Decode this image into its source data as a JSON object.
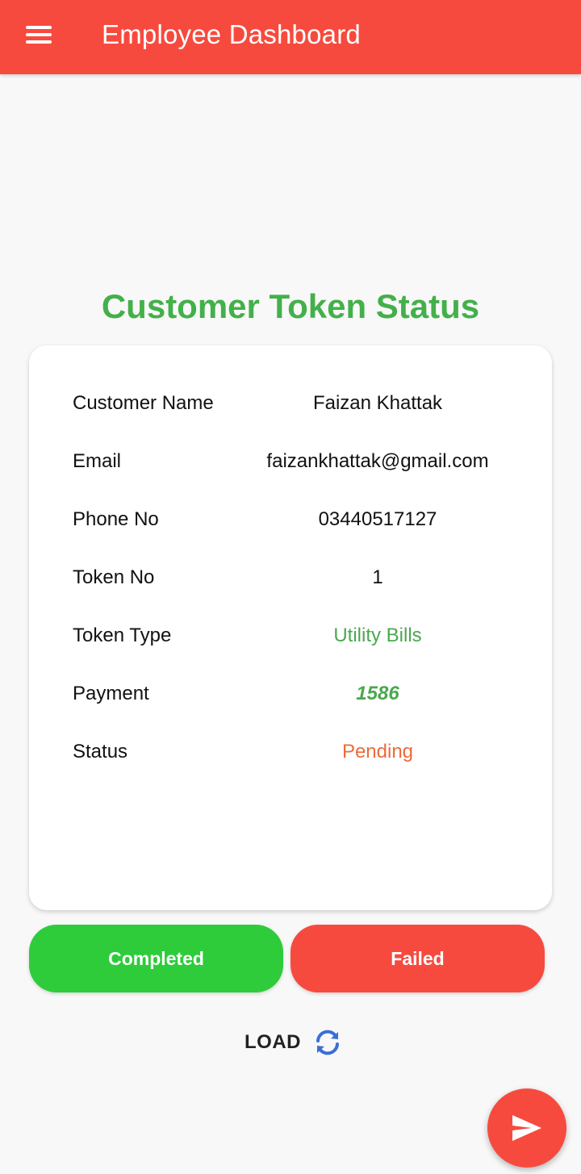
{
  "appbar": {
    "title": "Employee Dashboard",
    "menu_icon": "hamburger-menu-icon",
    "background": "#f74a3e"
  },
  "section_title": "Customer Token Status",
  "details": [
    {
      "label": "Customer Name",
      "value": "Faizan Khattak"
    },
    {
      "label": "Email",
      "value": "faizankhattak@gmail.com"
    },
    {
      "label": "Phone No",
      "value": "03440517127"
    },
    {
      "label": "Token No",
      "value": "1"
    },
    {
      "label": "Token Type",
      "value": "Utility Bills"
    },
    {
      "label": "Payment",
      "value": "1586"
    },
    {
      "label": "Status",
      "value": "Pending"
    }
  ],
  "actions": {
    "completed_label": "Completed",
    "failed_label": "Failed"
  },
  "load": {
    "label": "LOAD",
    "icon": "refresh-icon"
  },
  "fab": {
    "icon": "send-icon"
  },
  "colors": {
    "accent_red": "#f74a3e",
    "title_green": "#43b04a",
    "completed_green": "#2ecc3a",
    "status_orange": "#ee6a3a"
  }
}
